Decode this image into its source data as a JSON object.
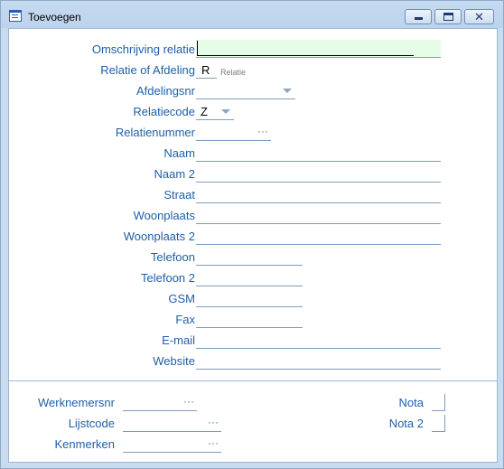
{
  "window": {
    "title": "Toevoegen",
    "icon": "form-icon",
    "controls": {
      "minimize": "minimize-icon",
      "maximize": "maximize-icon",
      "close": "close-icon"
    }
  },
  "form": {
    "omschrijving": {
      "label": "Omschrijving relatie",
      "value": ""
    },
    "relatie_afdeling": {
      "label": "Relatie of Afdeling",
      "value": "R",
      "hint": "Relatie"
    },
    "afdelingsnr": {
      "label": "Afdelingsnr",
      "value": ""
    },
    "relatiecode": {
      "label": "Relatiecode",
      "value": "Z"
    },
    "relatienummer": {
      "label": "Relatienummer",
      "value": "",
      "ellipsis": "···"
    },
    "naam": {
      "label": "Naam",
      "value": ""
    },
    "naam2": {
      "label": "Naam 2",
      "value": ""
    },
    "straat": {
      "label": "Straat",
      "value": ""
    },
    "woonplaats": {
      "label": "Woonplaats",
      "value": ""
    },
    "woonplaats2": {
      "label": "Woonplaats 2",
      "value": ""
    },
    "telefoon": {
      "label": "Telefoon",
      "value": ""
    },
    "telefoon2": {
      "label": "Telefoon 2",
      "value": ""
    },
    "gsm": {
      "label": "GSM",
      "value": ""
    },
    "fax": {
      "label": "Fax",
      "value": ""
    },
    "email": {
      "label": "E-mail",
      "value": ""
    },
    "website": {
      "label": "Website",
      "value": ""
    }
  },
  "footer": {
    "werknemersnr": {
      "label": "Werknemersnr",
      "value": "",
      "ellipsis": "···"
    },
    "lijstcode": {
      "label": "Lijstcode",
      "value": "",
      "ellipsis": "···"
    },
    "kenmerken": {
      "label": "Kenmerken",
      "value": "",
      "ellipsis": "···"
    },
    "nota": {
      "label": "Nota",
      "checked": false
    },
    "nota2": {
      "label": "Nota 2",
      "checked": false
    }
  }
}
